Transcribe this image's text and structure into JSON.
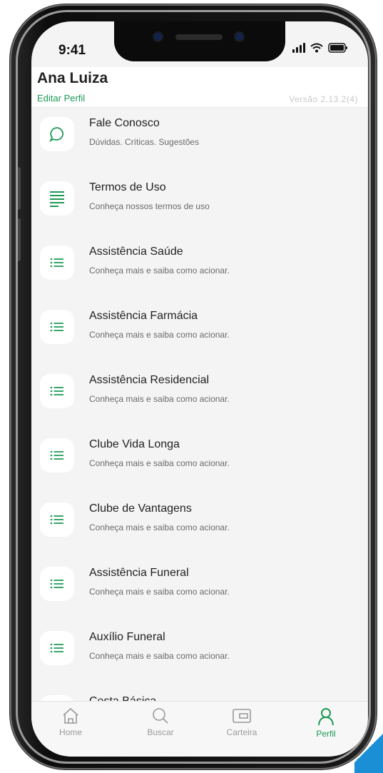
{
  "status_bar": {
    "time": "9:41"
  },
  "header": {
    "user_name": "Ana Luiza",
    "edit_profile_label": "Editar Perfil",
    "version": "Versão 2.13.2(4)"
  },
  "menu": {
    "items": [
      {
        "title": "Fale Conosco",
        "subtitle": "Dúvidas. Críticas. Sugestões",
        "icon": "chat-bubble-icon"
      },
      {
        "title": "Termos de Uso",
        "subtitle": "Conheça nossos termos de uso",
        "icon": "document-lines-icon"
      },
      {
        "title": "Assistência Saúde",
        "subtitle": "Conheça mais e saiba como acionar.",
        "icon": "list-icon"
      },
      {
        "title": "Assistência Farmácia",
        "subtitle": "Conheça mais e saiba como acionar.",
        "icon": "list-icon"
      },
      {
        "title": "Assistência Residencial",
        "subtitle": "Conheça mais e saiba como acionar.",
        "icon": "list-icon"
      },
      {
        "title": "Clube Vida Longa",
        "subtitle": "Conheça mais e saiba como acionar.",
        "icon": "list-icon"
      },
      {
        "title": "Clube de Vantagens",
        "subtitle": "Conheça mais e saiba como acionar.",
        "icon": "list-icon"
      },
      {
        "title": "Assistência Funeral",
        "subtitle": "Conheça mais e saiba como acionar.",
        "icon": "list-icon"
      },
      {
        "title": "Auxílio Funeral",
        "subtitle": "Conheça mais e saiba como acionar.",
        "icon": "list-icon"
      },
      {
        "title": "Cesta Básica",
        "subtitle": "",
        "icon": "list-icon"
      }
    ]
  },
  "tabbar": {
    "tabs": [
      {
        "label": "Home",
        "icon": "home-icon",
        "active": false
      },
      {
        "label": "Buscar",
        "icon": "search-icon",
        "active": false
      },
      {
        "label": "Carteira",
        "icon": "wallet-icon",
        "active": false
      },
      {
        "label": "Perfil",
        "icon": "profile-icon",
        "active": true
      }
    ]
  },
  "colors": {
    "accent": "#1e9a55",
    "inactive": "#9a9a9a",
    "background": "#f4f4f4"
  }
}
